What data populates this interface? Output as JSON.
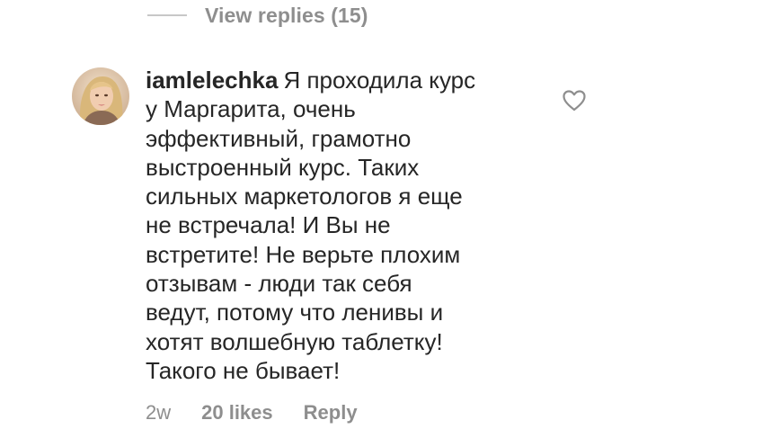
{
  "view_replies": {
    "label": "View replies (15)"
  },
  "comment": {
    "username": "iamlelechka",
    "text": "Я проходила курс\nу Маргарита, очень\nэффективный, грамотно\nвыстроенный курс. Таких\nсильных маркетологов я еще\nне встречала! И Вы не\nвстретите! Не верьте плохим\nотзывам - люди так себя\nведут, потому что ленивы и\nхотят волшебную таблетку!\nТакого не бывает!",
    "time": "2w",
    "likes": "20 likes",
    "reply_label": "Reply"
  },
  "icons": {
    "like": "heart-icon",
    "avatar": "user-avatar"
  },
  "colors": {
    "text": "#262626",
    "secondary": "#8e8e8e",
    "divider": "#c7c7c7"
  }
}
